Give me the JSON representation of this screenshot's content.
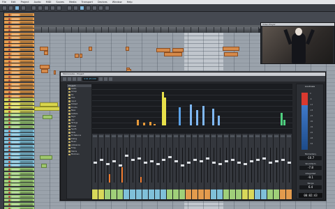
{
  "menubar": {
    "items": [
      "File",
      "Edit",
      "Project",
      "Audio",
      "MIDI",
      "Scores",
      "Media",
      "Transport",
      "Devices",
      "Window",
      "Help"
    ]
  },
  "video_window": {
    "title": "Video Player"
  },
  "mixer": {
    "title": "MixConsole - Project",
    "transport_readout": "0:01:25.020",
    "browser_header": "Project",
    "browser_items": [
      "Audio",
      "Group",
      "FX",
      "VCA",
      "Input",
      "Output",
      "Drums",
      "Bass",
      "Guitars",
      "Keys",
      "Vox",
      "Strings",
      "Brass",
      "Synth",
      "Pads",
      "FX Returns",
      "Dialog",
      "Music",
      "Ambience",
      "Foley",
      "Stems",
      "Mixdown"
    ],
    "loudness_panel": {
      "title": "Loudness",
      "scale": [
        "0",
        "-6",
        "-12",
        "-18",
        "-24",
        "-30",
        "-36",
        "-42",
        "-48",
        "-54"
      ],
      "readouts": [
        {
          "label": "Momentary",
          "value": "-10.7"
        },
        {
          "label": "Short-Term",
          "value": "-7.8"
        },
        {
          "label": "Integrated",
          "value": "-9.1"
        },
        {
          "label": "Range",
          "value": "6.4"
        }
      ],
      "timecode": "00:02:43"
    }
  },
  "colors": {
    "clip_orange": "#d58a4a",
    "clip_yellow": "#d8d54c",
    "clip_green": "#9fc76d",
    "meter_red": "#d9392f",
    "meter_blue": "#3f79c9"
  }
}
